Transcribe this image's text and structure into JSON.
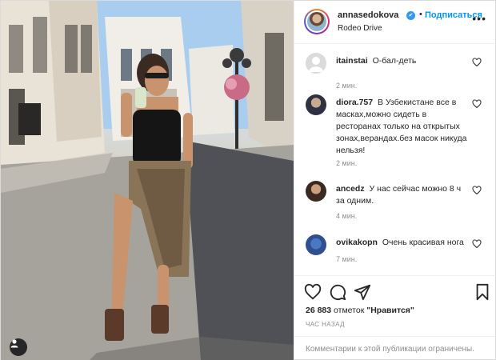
{
  "header": {
    "username": "annasedokova",
    "verified_mark": "✔",
    "separator": "•",
    "follow_label": "Подписаться",
    "location": "Rodeo Drive",
    "more_icon": "more-horizontal-icon"
  },
  "comments": [
    {
      "user": "itainstai",
      "text": "О-бал-деть",
      "time": "2 мин."
    },
    {
      "user": "diora.757",
      "text": "В Узбекистане все в масках,можно сидеть в ресторанах только на открытых зонах,верандах.без масок никуда нельзя!",
      "time": "2 мин."
    },
    {
      "user": "ancedz",
      "text": "У нас сейчас можно 8 ч за одним.",
      "time": "4 мин."
    },
    {
      "user": "ovikakopn",
      "text": "Очень красивая нога",
      "time": "7 мин."
    }
  ],
  "actions": {
    "like_icon": "heart-icon",
    "comment_icon": "comment-icon",
    "share_icon": "paper-plane-icon",
    "save_icon": "bookmark-icon"
  },
  "likes": {
    "count": "26 883",
    "word": "отметок",
    "link": "\"Нравится\""
  },
  "time_ago": "ЧАС НАЗАД",
  "comments_restricted": "Комментарии к этой публикации ограничены.",
  "colors": {
    "accent": "#0095f6",
    "text": "#262626",
    "muted": "#8e8e8e",
    "border": "#efefef"
  }
}
